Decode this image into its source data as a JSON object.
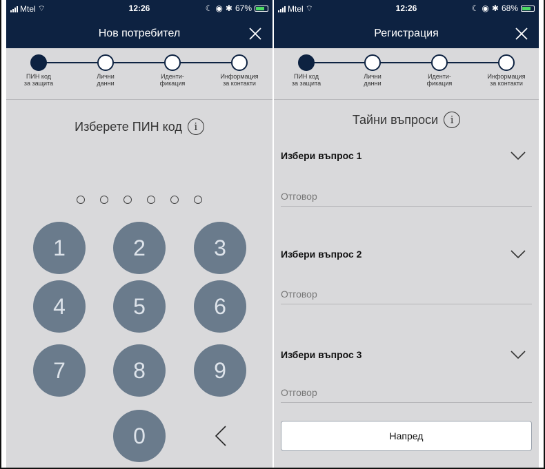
{
  "status_bar": {
    "carrier": "Mtel",
    "time": "12:26"
  },
  "screens": [
    {
      "battery": "67%",
      "title": "Нов потребител",
      "steps": [
        {
          "l1": "ПИН код",
          "l2": "за защита"
        },
        {
          "l1": "Лични",
          "l2": "данни"
        },
        {
          "l1": "Иденти-",
          "l2": "фикация"
        },
        {
          "l1": "Информация",
          "l2": "за контакти"
        }
      ],
      "heading": "Изберете ПИН код",
      "keypad": [
        "1",
        "2",
        "3",
        "4",
        "5",
        "6",
        "7",
        "8",
        "9",
        "0"
      ]
    },
    {
      "battery": "68%",
      "title": "Регистрация",
      "steps": [
        {
          "l1": "ПИН код",
          "l2": "за защита"
        },
        {
          "l1": "Лични",
          "l2": "данни"
        },
        {
          "l1": "Иденти-",
          "l2": "фикация"
        },
        {
          "l1": "Информация",
          "l2": "за контакти"
        }
      ],
      "heading": "Тайни въпроси",
      "questions": [
        {
          "label": "Избери въпрос 1",
          "placeholder": "Отговор"
        },
        {
          "label": "Избери въпрос 2",
          "placeholder": "Отговор"
        },
        {
          "label": "Избери въпрос 3",
          "placeholder": "Отговор"
        }
      ],
      "next_label": "Напред"
    }
  ],
  "info_glyph": "i",
  "colors": {
    "nav": "#0d2241",
    "key": "#6a7b8c",
    "background": "#d9d9db"
  }
}
